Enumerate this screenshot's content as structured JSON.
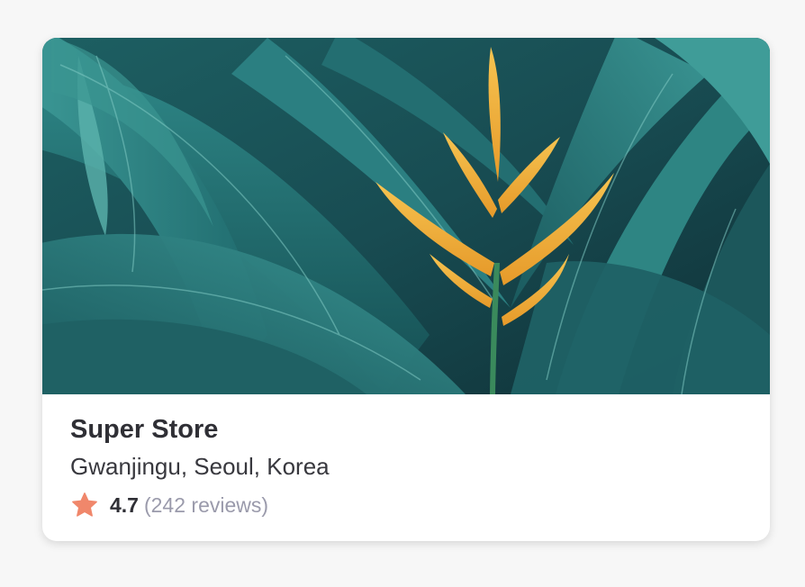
{
  "card": {
    "image_alt": "Tropical leaves with an orange heliconia flower",
    "title": "Super Store",
    "location": "Gwanjingu, Seoul, Korea",
    "rating": {
      "value": "4.7",
      "reviews_text": "(242 reviews)",
      "star_icon": "star-icon",
      "star_color": "#f0876b"
    }
  },
  "colors": {
    "background": "#f7f7f7",
    "card_background": "#ffffff",
    "title": "#2f2f35",
    "muted": "#9a9aab",
    "leaf": "#2c7d7f",
    "flower": "#f0b13d"
  }
}
